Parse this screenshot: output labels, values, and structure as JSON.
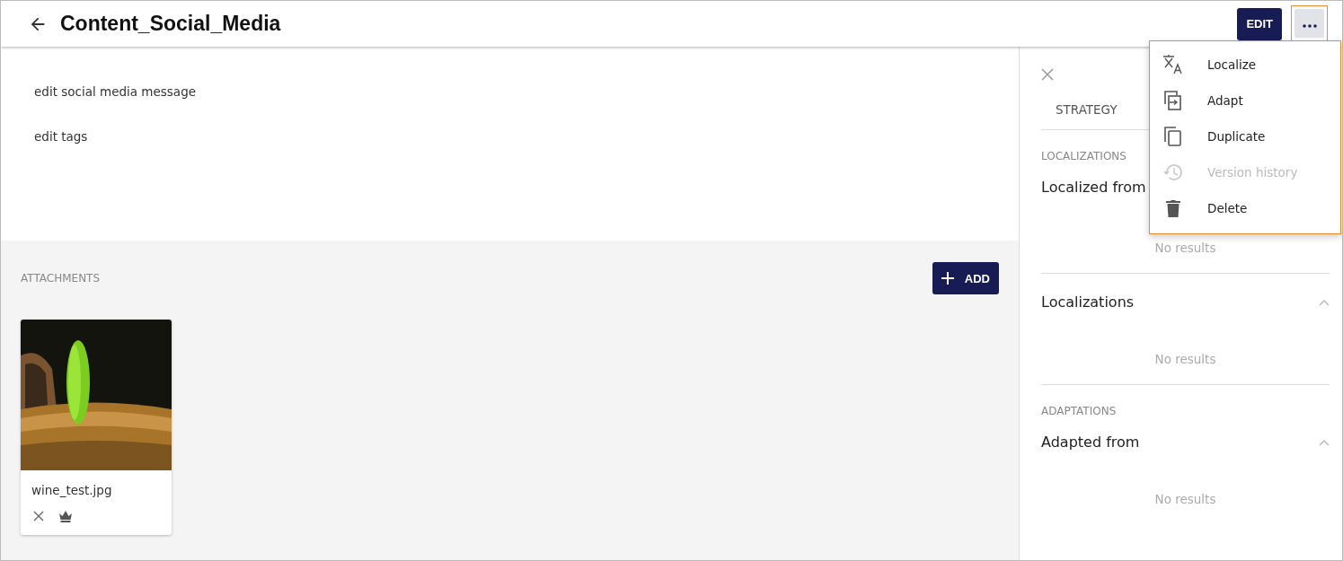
{
  "header": {
    "title": "Content_Social_Media",
    "edit_button": "EDIT"
  },
  "content": {
    "lines": [
      "edit social media message",
      "edit tags"
    ]
  },
  "attachments": {
    "heading": "ATTACHMENTS",
    "add_button": "ADD",
    "items": [
      {
        "kind": "picture",
        "file_name": "wine_test.jpg"
      }
    ]
  },
  "side_panel": {
    "tabs": [
      {
        "label": "STRATEGY",
        "selected": false
      }
    ],
    "sections": [
      {
        "heading": "LOCALIZATIONS",
        "title": "Localized from",
        "empty_text": "No results"
      },
      {
        "title": "Localizations",
        "expanded": true,
        "empty_text": "No results"
      },
      {
        "heading": "ADAPTATIONS",
        "title": "Adapted from",
        "expanded": true,
        "empty_text": "No results"
      }
    ]
  },
  "menu": {
    "items": [
      {
        "kind": "translate",
        "label": "Localize",
        "disabled": false
      },
      {
        "kind": "adapt",
        "label": "Adapt",
        "disabled": false
      },
      {
        "kind": "duplicate",
        "label": "Duplicate",
        "disabled": false
      },
      {
        "kind": "history",
        "label": "Version history",
        "disabled": true
      },
      {
        "kind": "delete",
        "label": "Delete",
        "disabled": false
      }
    ]
  }
}
